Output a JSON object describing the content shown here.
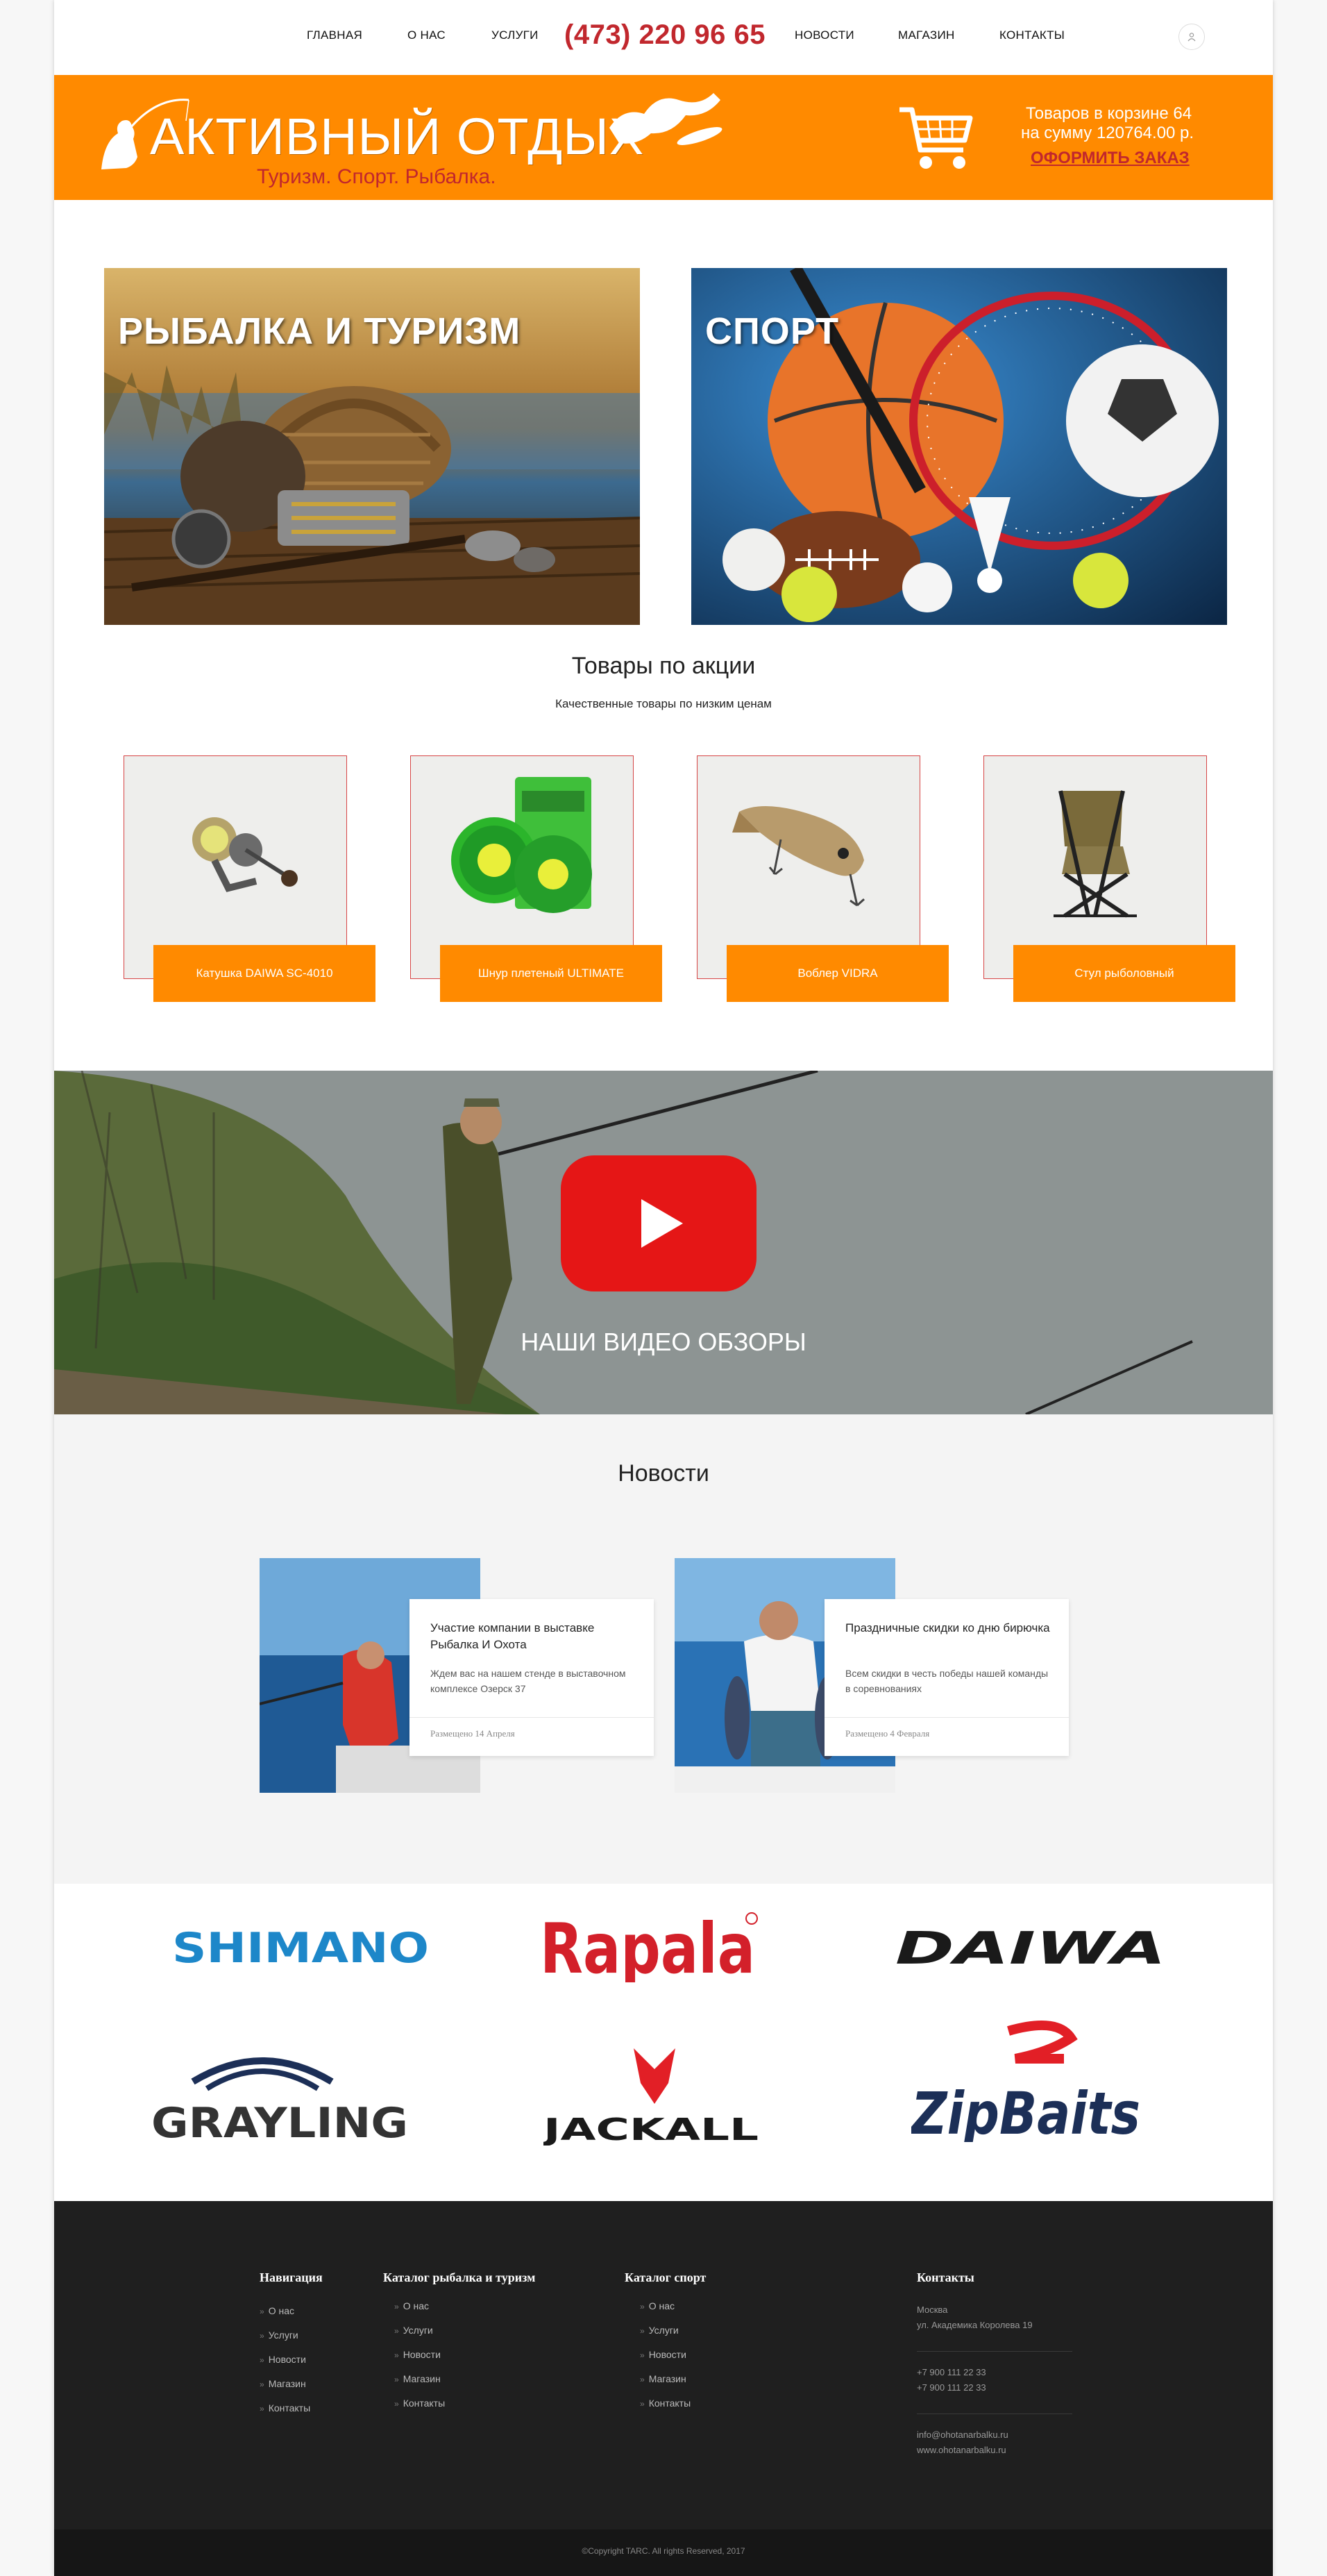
{
  "nav": {
    "items": [
      "ГЛАВНАЯ",
      "О НАС",
      "УСЛУГИ",
      "НОВОСТИ",
      "МАГАЗИН",
      "КОНТАКТЫ"
    ],
    "phone": "(473) 220 96 65"
  },
  "header": {
    "logo_title": "АКТИВНЫЙ ОТДЫХ",
    "logo_subtitle": "Туризм. Спорт. Рыбалка.",
    "cart_count": "Товаров в корзине 64",
    "cart_sum": "на сумму  120764.00 р.",
    "order_link": "ОФОРМИТЬ ЗАКАЗ"
  },
  "categories": [
    {
      "title": "РЫБАЛКА И ТУРИЗМ"
    },
    {
      "title": "СПОРТ"
    }
  ],
  "promo": {
    "title": "Товары по акции",
    "subtitle": "Качественные товары по низким ценам",
    "products": [
      {
        "label": "Катушка DAIWA SC-4010"
      },
      {
        "label": "Шнур плетеный ULTIMATE"
      },
      {
        "label": "Воблер VIDRA"
      },
      {
        "label": "Стул рыболовный"
      }
    ]
  },
  "video": {
    "label": "НАШИ ВИДЕО ОБЗОРЫ"
  },
  "news": {
    "title": "Новости",
    "items": [
      {
        "title": "Участие компании в выставке Рыбалка И Охота",
        "text": "Ждем вас на нашем стенде в выставочном комплексе Озерск 37",
        "date": "Размещено 14 Апреля"
      },
      {
        "title": "Праздничные скидки ко дню бирючка",
        "text": "Всем скидки в честь победы нашей команды в соревнованиях",
        "date": "Размещено 4 Февраля"
      }
    ]
  },
  "brands": [
    "SHIMANO",
    "Rapala",
    "DAIWA",
    "GRAYLING",
    "JACKALL",
    "ZipBaits"
  ],
  "footer": {
    "nav_heading": "Навигация",
    "nav_items": [
      "О нас",
      "Услуги",
      "Новости",
      "Магазин",
      "Контакты"
    ],
    "fishing_heading": "Каталог рыбалка и туризм",
    "fishing_items": [
      "О нас",
      "Услуги",
      "Новости",
      "Магазин",
      "Контакты"
    ],
    "sport_heading": "Каталог спорт",
    "sport_items": [
      "О нас",
      "Услуги",
      "Новости",
      "Магазин",
      "Контакты"
    ],
    "contacts_heading": "Контакты",
    "city": "Москва",
    "address": "ул. Академика Королева 19",
    "phone1": "+7 900 111 22 33",
    "phone2": "+7 900 111 22 33",
    "email": "info@ohotanarbalku.ru",
    "site": "www.ohotanarbalku.ru",
    "copyright": "©Copyright TARC. All rights Reserved, 2017"
  },
  "colors": {
    "accent": "#ff8a00",
    "brand_red": "#c1272d",
    "footer": "#1f1f1f"
  }
}
